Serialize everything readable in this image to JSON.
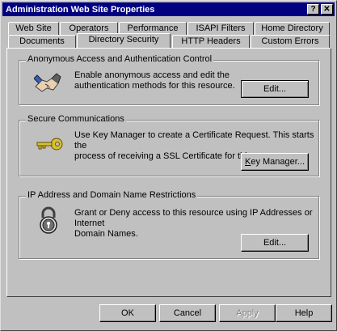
{
  "window": {
    "title": "Administration Web Site Properties",
    "help_button": "?",
    "close_button": "✕"
  },
  "tabs": {
    "row1": [
      {
        "label": "Web Site"
      },
      {
        "label": "Operators"
      },
      {
        "label": "Performance"
      },
      {
        "label": "ISAPI Filters"
      },
      {
        "label": "Home Directory"
      }
    ],
    "row2": [
      {
        "label": "Documents"
      },
      {
        "label": "Directory Security"
      },
      {
        "label": "HTTP Headers"
      },
      {
        "label": "Custom Errors"
      }
    ],
    "active": "Directory Security"
  },
  "anonymous": {
    "title": "Anonymous Access and Authentication Control",
    "line1": "Enable anonymous access and edit the",
    "line2": "authentication methods for this resource.",
    "button": "Edit...",
    "icon": "handshake-icon"
  },
  "secure": {
    "title": "Secure Communications",
    "line1": "Use Key Manager to create a Certificate Request.  This starts the",
    "line2": "process of receiving a SSL Certificate for this resource.",
    "button_prefix": "K",
    "button_rest": "ey Manager...",
    "icon": "key-icon"
  },
  "ip": {
    "title": "IP Address and Domain Name Restrictions",
    "line1": "Grant or Deny access to this resource using IP Addresses or Internet",
    "line2": "Domain Names.",
    "button": "Edit...",
    "icon": "padlock-icon"
  },
  "footer": {
    "ok": "OK",
    "cancel": "Cancel",
    "apply": "Apply",
    "help": "Help"
  }
}
